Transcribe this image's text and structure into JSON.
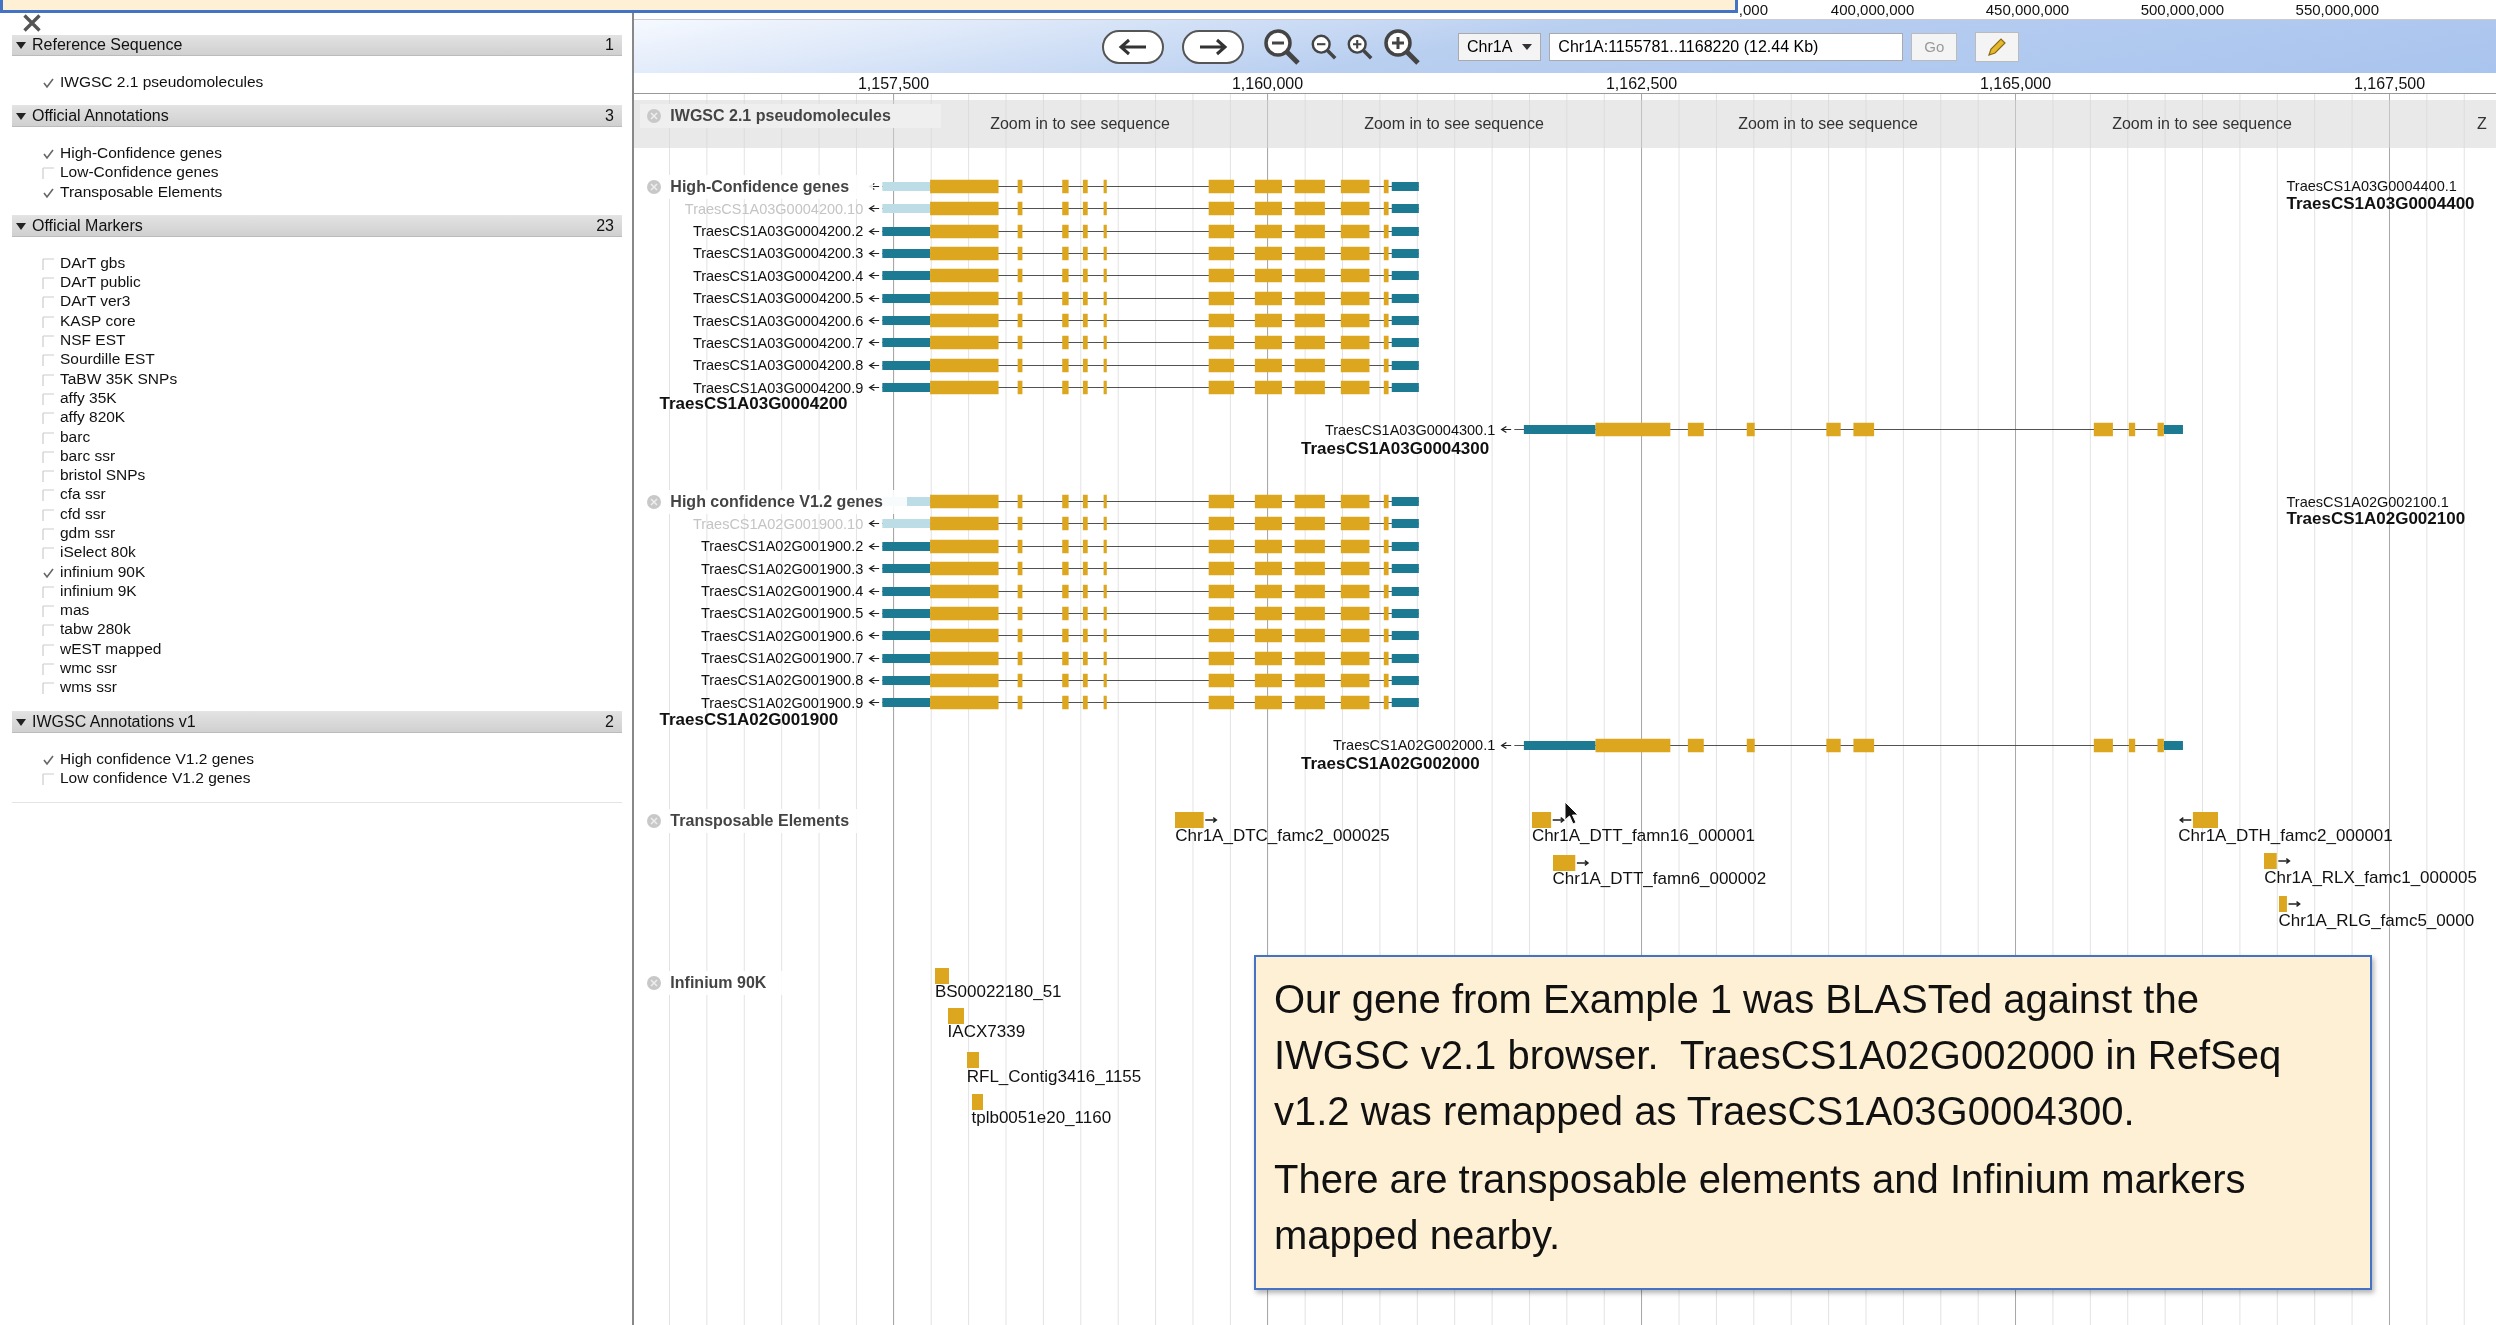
{
  "sidebar": {
    "sections": [
      {
        "title": "Reference Sequence",
        "count": "1",
        "expanded": true,
        "tracks": [
          {
            "label": "IWGSC 2.1 pseudomolecules",
            "checked": true
          }
        ]
      },
      {
        "title": "Official Annotations",
        "count": "3",
        "expanded": true,
        "tracks": [
          {
            "label": "High-Confidence genes",
            "checked": true
          },
          {
            "label": "Low-Confidence genes",
            "checked": false
          },
          {
            "label": "Transposable Elements",
            "checked": true
          }
        ]
      },
      {
        "title": "Official Markers",
        "count": "23",
        "expanded": true,
        "tracks": [
          {
            "label": "DArT gbs",
            "checked": false
          },
          {
            "label": "DArT public",
            "checked": false
          },
          {
            "label": "DArT ver3",
            "checked": false
          },
          {
            "label": "KASP core",
            "checked": false
          },
          {
            "label": "NSF EST",
            "checked": false
          },
          {
            "label": "Sourdille EST",
            "checked": false
          },
          {
            "label": "TaBW 35K SNPs",
            "checked": false
          },
          {
            "label": "affy 35K",
            "checked": false
          },
          {
            "label": "affy 820K",
            "checked": false
          },
          {
            "label": "barc",
            "checked": false
          },
          {
            "label": "barc ssr",
            "checked": false
          },
          {
            "label": "bristol SNPs",
            "checked": false
          },
          {
            "label": "cfa ssr",
            "checked": false
          },
          {
            "label": "cfd ssr",
            "checked": false
          },
          {
            "label": "gdm ssr",
            "checked": false
          },
          {
            "label": "iSelect 80k",
            "checked": false
          },
          {
            "label": "infinium 90K",
            "checked": true
          },
          {
            "label": "infinium 9K",
            "checked": false
          },
          {
            "label": "mas",
            "checked": false
          },
          {
            "label": "tabw 280k",
            "checked": false
          },
          {
            "label": "wEST mapped",
            "checked": false
          },
          {
            "label": "wmc ssr",
            "checked": false
          },
          {
            "label": "wms ssr",
            "checked": false
          }
        ]
      },
      {
        "title": "IWGSC Annotations v1",
        "count": "2",
        "expanded": true,
        "tracks": [
          {
            "label": "High confidence V1.2 genes",
            "checked": true
          },
          {
            "label": "Low confidence V1.2 genes",
            "checked": false
          }
        ]
      }
    ]
  },
  "overview": {
    "ticks": [
      ",000",
      "400,000,000",
      "450,000,000",
      "500,000,000",
      "550,000,000"
    ]
  },
  "navigation": {
    "chromosome": "Chr1A",
    "location": "Chr1A:1155781..1168220 (12.44 Kb)",
    "go": "Go"
  },
  "ruler": {
    "ticks": [
      "1,157,500",
      "1,160,000",
      "1,162,500",
      "1,165,000",
      "1,167,500"
    ]
  },
  "tracks": [
    {
      "kind": "sequence",
      "label": "IWGSC 2.1 pseudomolecules",
      "messages": [
        "Zoom in to see sequence",
        "Zoom in to see sequence",
        "Zoom in to see sequence",
        "Zoom in to see sequence",
        "Z"
      ]
    },
    {
      "kind": "genes",
      "label": "High-Confidence genes",
      "genes": [
        {
          "kind": "cluster",
          "name": "TraesCS1A03G0004200",
          "transcripts": [
            {
              "faded": true
            },
            {
              "name": "TraesCS1A03G0004200.10",
              "faded": true
            },
            {
              "name": "TraesCS1A03G0004200.2",
              "faded": false
            },
            {
              "name": "TraesCS1A03G0004200.3",
              "faded": false
            },
            {
              "name": "TraesCS1A03G0004200.4",
              "faded": false
            },
            {
              "name": "TraesCS1A03G0004200.5",
              "faded": false
            },
            {
              "name": "TraesCS1A03G0004200.6",
              "faded": false
            },
            {
              "name": "TraesCS1A03G0004200.7",
              "faded": false
            },
            {
              "name": "TraesCS1A03G0004200.8",
              "faded": false
            },
            {
              "name": "TraesCS1A03G0004200.9",
              "faded": false
            }
          ]
        },
        {
          "kind": "single",
          "name": "TraesCS1A03G0004300",
          "transcripts": [
            {
              "name": "TraesCS1A03G0004300.1",
              "faded": false
            }
          ]
        },
        {
          "kind": "label_only",
          "name": "TraesCS1A03G0004400",
          "transcripts": [
            {
              "name": "TraesCS1A03G0004400.1"
            }
          ]
        }
      ]
    },
    {
      "kind": "genes",
      "label": "High confidence V1.2 genes",
      "genes": [
        {
          "kind": "cluster",
          "name": "TraesCS1A02G001900",
          "transcripts": [
            {
              "faded": true
            },
            {
              "name": "TraesCS1A02G001900.10",
              "faded": true
            },
            {
              "name": "TraesCS1A02G001900.2",
              "faded": false
            },
            {
              "name": "TraesCS1A02G001900.3",
              "faded": false
            },
            {
              "name": "TraesCS1A02G001900.4",
              "faded": false
            },
            {
              "name": "TraesCS1A02G001900.5",
              "faded": false
            },
            {
              "name": "TraesCS1A02G001900.6",
              "faded": false
            },
            {
              "name": "TraesCS1A02G001900.7",
              "faded": false
            },
            {
              "name": "TraesCS1A02G001900.8",
              "faded": false
            },
            {
              "name": "TraesCS1A02G001900.9",
              "faded": false
            }
          ]
        },
        {
          "kind": "single",
          "name": "TraesCS1A02G002000",
          "transcripts": [
            {
              "name": "TraesCS1A02G002000.1",
              "faded": false
            }
          ]
        },
        {
          "kind": "label_only",
          "name": "TraesCS1A02G002100",
          "transcripts": [
            {
              "name": "TraesCS1A02G002100.1"
            }
          ]
        }
      ]
    },
    {
      "kind": "features",
      "label": "Transposable Elements",
      "features": [
        {
          "name": "Chr1A_DTC_famc2_000025",
          "reverse": false
        },
        {
          "name": "Chr1A_DTT_famn16_000001",
          "reverse": false
        },
        {
          "name": "Chr1A_DTT_famn6_000002",
          "reverse": false
        },
        {
          "name": "Chr1A_DTH_famc2_000001",
          "reverse": true
        },
        {
          "name": "Chr1A_RLX_famc1_000005",
          "reverse": false
        },
        {
          "name": "Chr1A_RLG_famc5_0000",
          "reverse": false
        }
      ]
    },
    {
      "kind": "markers",
      "label": "Infinium 90K",
      "markers": [
        {
          "name": "BS00022180_51"
        },
        {
          "name": "IACX7339"
        },
        {
          "name": "RFL_Contig3416_1155"
        },
        {
          "name": "tplb0051e20_1160"
        }
      ]
    }
  ],
  "callout": {
    "paragraphs": [
      "Our gene from Example 1 was BLASTed against the IWGSC v2.1 browser.  TraesCS1A02G002000 in RefSeq v1.2 was remapped as TraesCS1A03G0004300.",
      "There are transposable elements and Infinium markers mapped nearby."
    ]
  }
}
